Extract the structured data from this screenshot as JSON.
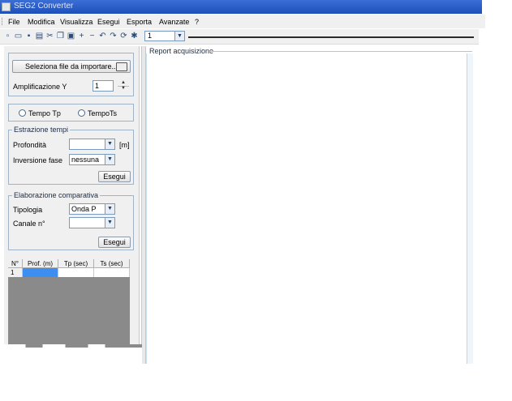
{
  "window": {
    "title": "SEG2 Converter"
  },
  "menu": {
    "items": [
      "File",
      "Modifica",
      "Visualizza",
      "Esegui",
      "Esporta",
      "Avanzate",
      "?"
    ]
  },
  "toolbar": {
    "icons": [
      "new-file-icon",
      "open-folder-icon",
      "save-icon",
      "print-icon",
      "cut-icon",
      "copy-icon",
      "paste-icon",
      "zoom-in-icon",
      "zoom-out-icon",
      "undo-icon",
      "redo-icon",
      "refresh-icon",
      "settings-icon"
    ],
    "zoom_value": "1"
  },
  "import": {
    "select_button": "Seleziona file da importare...",
    "amp_label": "Amplificazione Y",
    "amp_value": "1"
  },
  "time": {
    "tp": "Tempo Tp",
    "ts": "TempoTs"
  },
  "estrazione": {
    "title": "Estrazione tempi",
    "profondita_label": "Profondità",
    "profondita_value": "",
    "unit": "[m]",
    "inversione_label": "Inversione fase",
    "inversione_value": "nessuna",
    "run": "Esegui"
  },
  "comparativa": {
    "title": "Elaborazione comparativa",
    "tipologia_label": "Tipologia",
    "tipologia_value": "Onda P",
    "canale_label": "Canale n°",
    "canale_value": "",
    "run": "Esegui"
  },
  "grid": {
    "headers": [
      "N°",
      "Prof. (m)",
      "Tp (sec)",
      "Ts (sec)"
    ],
    "rows": [
      [
        "1",
        "",
        "",
        ""
      ]
    ]
  },
  "report": {
    "title": "Report acquisizione"
  },
  "colors": {
    "titlebar": "#2a5cc8",
    "selection": "#3d8ef0"
  }
}
